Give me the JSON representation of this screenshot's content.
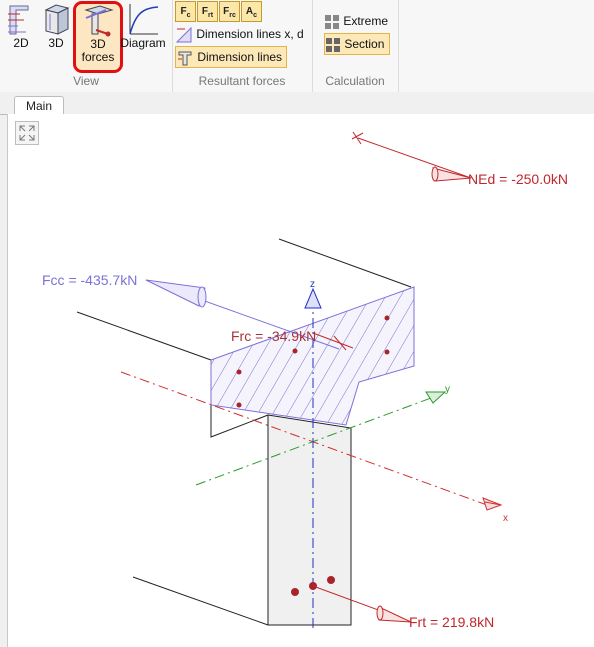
{
  "ribbon": {
    "view_group": {
      "label": "View",
      "buttons": [
        {
          "label": "2D"
        },
        {
          "label": "3D"
        },
        {
          "label": "3D forces",
          "label_line1": "3D",
          "label_line2": "forces",
          "active": true
        },
        {
          "label": "Diagram"
        }
      ]
    },
    "resultant_group": {
      "label": "Resultant forces",
      "toggles": [
        {
          "label": "Fc",
          "main": "F",
          "sub": "c"
        },
        {
          "label": "Frt",
          "main": "F",
          "sub": "rt"
        },
        {
          "label": "Frc",
          "main": "F",
          "sub": "rc"
        },
        {
          "label": "Ac",
          "main": "A",
          "sub": "c"
        }
      ],
      "dimension_lines_xd": "Dimension lines x, d",
      "dimension_lines": "Dimension lines"
    },
    "calculation_group": {
      "label": "Calculation",
      "extreme": "Extreme",
      "section": "Section",
      "section_active": true
    }
  },
  "tabs": [
    {
      "label": "Main",
      "active": true
    }
  ],
  "viewport": {
    "forces": {
      "ned": "NEd = -250.0kN",
      "fcc": "Fcc = -435.7kN",
      "frc": "Frc = -34.9kN",
      "frt": "Frt = 219.8kN"
    },
    "axes": {
      "x": "x",
      "y": "y",
      "z": "z"
    }
  },
  "colors": {
    "compression_force": "#7b72d8",
    "tension_force": "#c0282c",
    "axis_x": "#d03030",
    "axis_y": "#2a9a2a",
    "axis_z": "#2030c8",
    "ribbon_active": "#e01010",
    "hatch": "#7a6fd0"
  }
}
